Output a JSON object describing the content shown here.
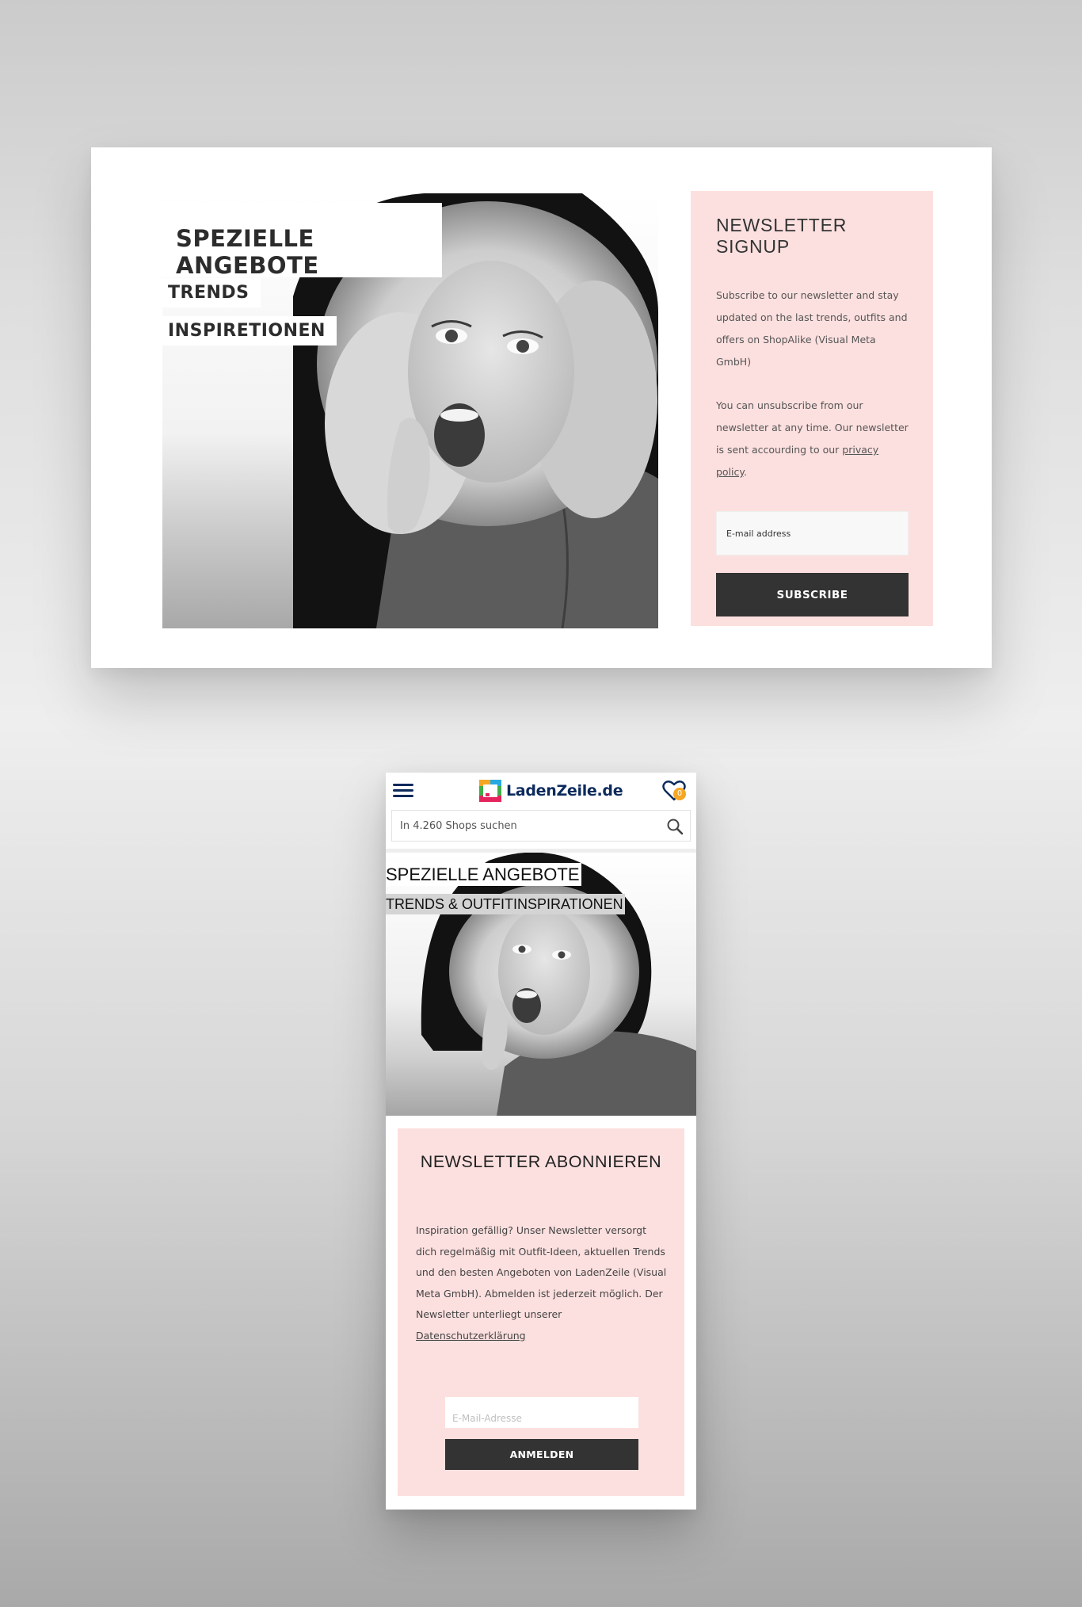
{
  "desktop": {
    "hero": {
      "title": "SPEZIELLE ANGEBOTE",
      "line1": "TRENDS",
      "line2": "INSPIRETIONEN"
    },
    "newsletter": {
      "title": "NEWSLETTER SIGNUP",
      "paragraph1": "Subscribe to our newsletter and stay updated on the last trends, outfits and offers on ShopAlike (Visual Meta GmbH)",
      "paragraph2_before": "You can unsubscribe from our newsletter at any time. Our newsletter is sent accourding to our ",
      "paragraph2_link": "privacy policy",
      "paragraph2_after": ".",
      "email_placeholder": "E-mail address",
      "button_label": "SUBSCRIBE"
    }
  },
  "mobile": {
    "header": {
      "logo_text": "LadenZeile.de",
      "wishlist_count": "0",
      "search_placeholder": "In 4.260 Shops suchen"
    },
    "hero": {
      "title": "SPEZIELLE ANGEBOTE",
      "subtitle": "TRENDS & OUTFITINSPIRATIONEN"
    },
    "newsletter": {
      "title": "NEWSLETTER ABONNIEREN",
      "paragraph": "Inspiration gefällig? Unser Newsletter versorgt dich regelmäßig mit Outfit-Ideen, aktuellen Trends und den besten Angeboten von LadenZeile (Visual Meta GmbH). Abmelden ist jederzeit möglich. Der Newsletter unterliegt unserer ",
      "link": "Datenschutzerklärung",
      "email_placeholder": "E-Mail-Adresse",
      "button_label": "ANMELDEN"
    }
  },
  "icons": [
    "hamburger-icon",
    "logo-icon",
    "heart-icon",
    "search-icon"
  ],
  "colors": {
    "newsletter_bg": "#fce0df",
    "button_bg": "#333333",
    "brand_navy": "#0c2a5c",
    "badge": "#f5a623"
  }
}
